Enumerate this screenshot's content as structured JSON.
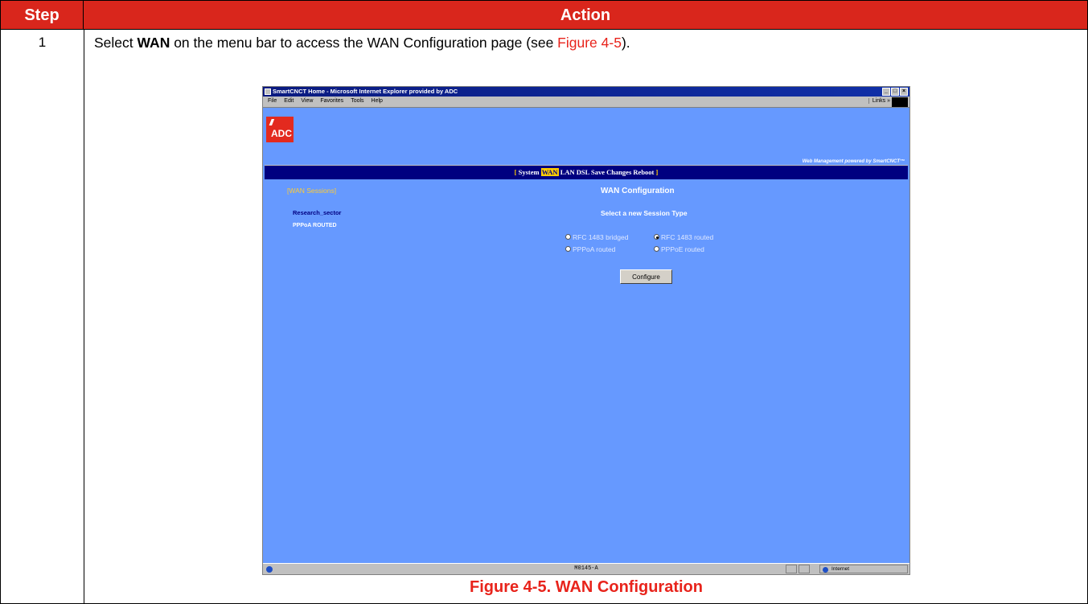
{
  "table": {
    "header_step": "Step",
    "header_action": "Action",
    "step_number": "1",
    "instruction_pre": "Select ",
    "instruction_bold": "WAN",
    "instruction_mid": " on the menu bar to access the WAN Configuration page (see ",
    "instruction_ref": "Figure 4-5",
    "instruction_post": ").",
    "caption": "Figure 4-5. WAN Configuration"
  },
  "browser": {
    "title": "SmartCNCT Home - Microsoft Internet Explorer provided by ADC",
    "menu_items": [
      "File",
      "Edit",
      "View",
      "Favorites",
      "Tools",
      "Help"
    ],
    "links_label": "Links »",
    "status_code": "M0145-A",
    "status_zone": "Internet"
  },
  "page": {
    "logo_text": "ADC",
    "powered_by": "Web Management powered by SmartCNCT™",
    "nav": {
      "open_bracket": "[ ",
      "items": [
        "System",
        "WAN",
        "LAN",
        "DSL",
        "Save Changes",
        "Reboot"
      ],
      "close_bracket": " ]",
      "selected": "WAN"
    },
    "sessions_label": "[WAN Sessions]",
    "session_name": "Research_sector",
    "session_type": "PPPoA ROUTED",
    "title": "WAN Configuration",
    "subtitle": "Select a new Session Type",
    "session_types": [
      {
        "label": "RFC 1483 bridged",
        "checked": false
      },
      {
        "label": "RFC 1483 routed",
        "checked": true
      },
      {
        "label": "PPPoA routed",
        "checked": false
      },
      {
        "label": "PPPoE routed",
        "checked": false
      }
    ],
    "configure_button": "Configure"
  },
  "colors": {
    "header_red": "#d9261c",
    "caption_red": "#e8231b",
    "page_blue": "#6699ff",
    "nav_navy": "#000080",
    "highlight_yellow": "#ffcc00"
  }
}
